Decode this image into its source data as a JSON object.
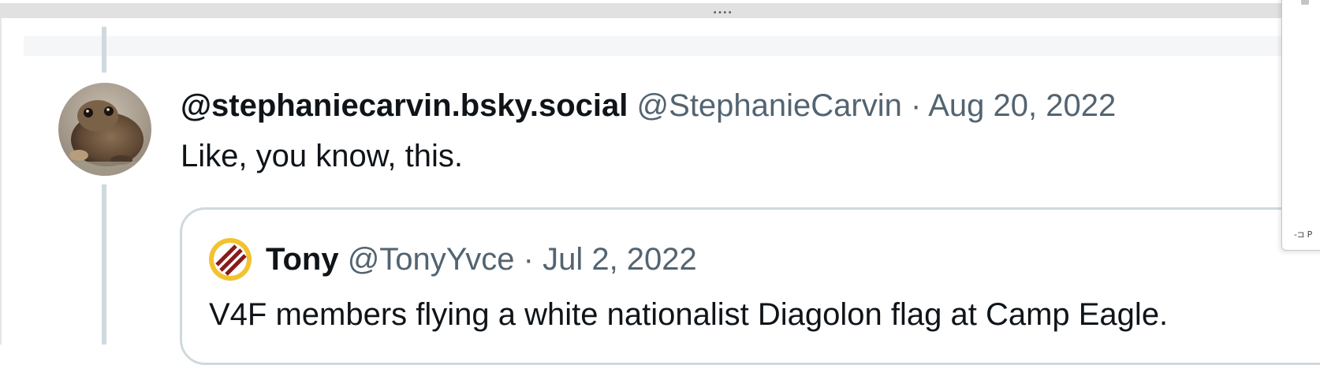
{
  "panel": {
    "resize_handle": "....",
    "pin_label": "-⊐ P"
  },
  "tweet": {
    "display_name": "@stephaniecarvin.bsky.social",
    "handle": "@StephanieCarvin",
    "separator": " · ",
    "date": "Aug 20, 2022",
    "text": "Like, you know, this."
  },
  "quoted_tweet": {
    "display_name": "Tony",
    "handle": "@TonyYvce",
    "separator": " · ",
    "date": "Jul 2, 2022",
    "text": "V4F members flying a white nationalist Diagolon flag at Camp Eagle."
  },
  "colors": {
    "text_primary": "#0f1419",
    "text_secondary": "#536471",
    "border": "#cfd9de",
    "flag_red": "#8b1a1a",
    "flag_gold": "#f2c230"
  },
  "icons": {
    "avatar": "frog-photo-avatar",
    "quote_avatar": "diagolon-flag-avatar"
  }
}
